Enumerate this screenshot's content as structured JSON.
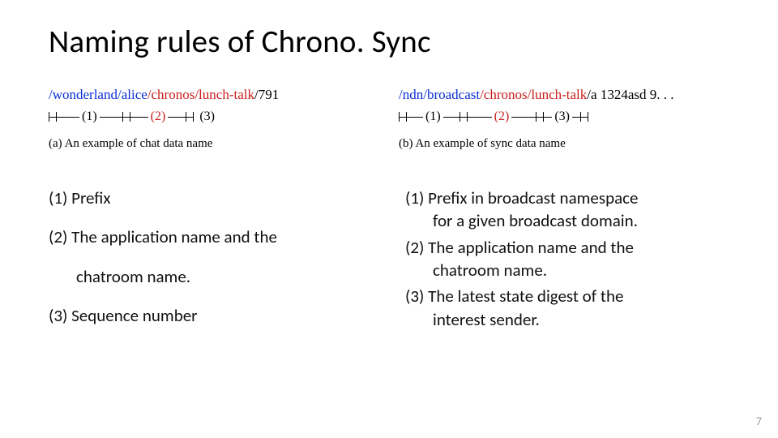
{
  "title": "Naming rules of Chrono. Sync",
  "example_a": {
    "prefix": "/wonderland/alice",
    "app": "/chronos/lunch-talk",
    "seq": "/791",
    "label_1": "(1)",
    "label_2": "(2)",
    "label_3": "(3)",
    "caption": "(a) An example of chat data name"
  },
  "example_b": {
    "prefix": "/ndn/broadcast",
    "app": "/chronos/lunch-talk",
    "digest": "/a 1324asd 9. . .",
    "label_1": "(1)",
    "label_2": "(2)",
    "label_3": "(3)",
    "caption": "(b) An example of sync data name"
  },
  "left_list": {
    "i1": "(1)  Prefix",
    "i2": "(2)  The application name and the",
    "i2b": "chatroom name.",
    "i3": "(3) Sequence number"
  },
  "right_list": {
    "i1": "(1)  Prefix in broadcast namespace",
    "i1b": "for a given broadcast domain.",
    "i2": "(2)  The application name and the",
    "i2b": "chatroom name.",
    "i3": "(3)  The latest state digest of the",
    "i3b": "interest sender."
  },
  "page_number": "7"
}
